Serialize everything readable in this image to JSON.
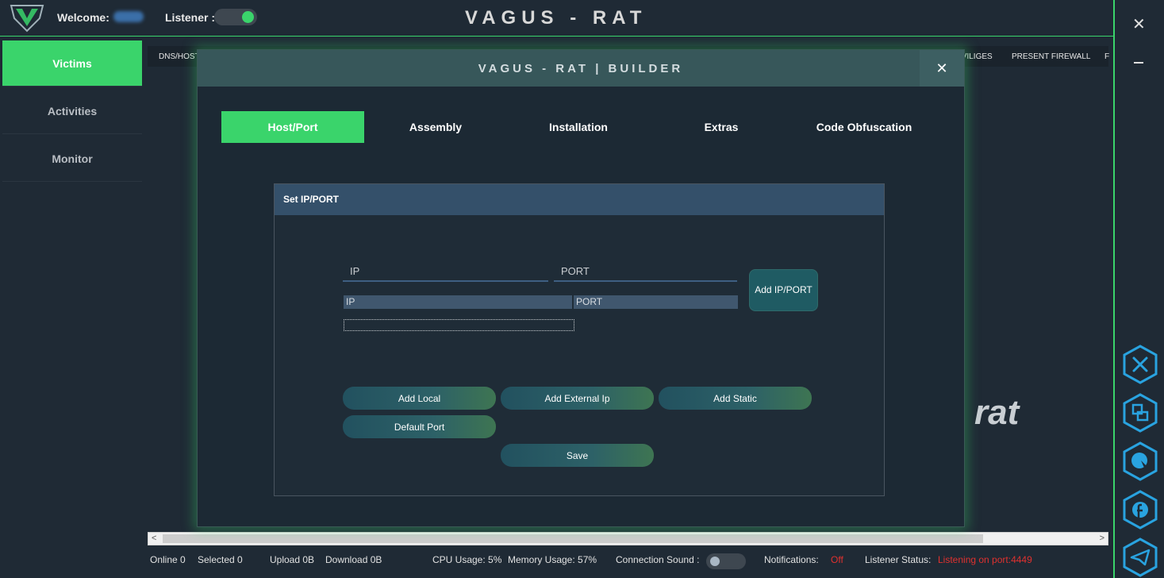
{
  "app": {
    "title": "VAGUS - RAT",
    "welcome_label": "Welcome:",
    "listener_label": "Listener :",
    "listener_on": true
  },
  "sidebar": {
    "items": [
      {
        "label": "Victims",
        "active": true
      },
      {
        "label": "Activities",
        "active": false
      },
      {
        "label": "Monitor",
        "active": false
      }
    ]
  },
  "columns": {
    "left": "DNS/HOST",
    "mid1": "IVILIGES",
    "mid2": "PRESENT FIREWALL",
    "right": "F"
  },
  "rail_icons": [
    "tools-icon",
    "windows-icon",
    "globe-cursor-icon",
    "facebook-icon",
    "telegram-icon"
  ],
  "watermark": {
    "rat": "rat"
  },
  "dialog": {
    "title": "VAGUS - RAT | BUILDER",
    "tabs": [
      {
        "label": "Host/Port",
        "active": true
      },
      {
        "label": "Assembly",
        "active": false
      },
      {
        "label": "Installation",
        "active": false
      },
      {
        "label": "Extras",
        "active": false
      },
      {
        "label": "Code Obfuscation",
        "active": false
      }
    ],
    "panel_title": "Set IP/PORT",
    "ip_placeholder": "IP",
    "port_placeholder": "PORT",
    "grid_headers": [
      "IP",
      "PORT"
    ],
    "add_button": "Add IP/PORT",
    "buttons": {
      "add_local": "Add Local",
      "add_external": "Add External Ip",
      "add_static": "Add Static",
      "default_port": "Default Port",
      "save": "Save"
    }
  },
  "status": {
    "online": "Online 0",
    "selected": "Selected 0",
    "upload": "Upload 0B",
    "download": "Download  0B",
    "cpu": "CPU Usage: 5%",
    "memory": "Memory Usage: 57%",
    "sound_label": "Connection Sound :",
    "notifications_label": "Notifications:",
    "notifications_value": "Off",
    "listener_status_label": "Listener Status:",
    "listener_status_value": "Listening on port:4449"
  },
  "colors": {
    "accent": "#3ad46b",
    "background": "#1f2a35",
    "alert": "#e0312f"
  }
}
